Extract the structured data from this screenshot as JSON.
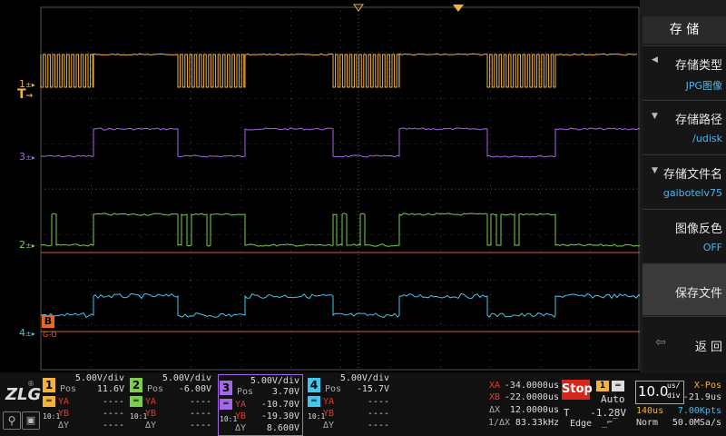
{
  "menu": {
    "title": "存 储",
    "items": [
      {
        "label": "存储类型",
        "value": "JPG图像"
      },
      {
        "label": "存储路径",
        "value": "/udisk"
      },
      {
        "label": "存储文件名",
        "value": "gaibotelv75"
      },
      {
        "label": "图像反色",
        "value": "OFF"
      },
      {
        "label": "保存文件"
      },
      {
        "label": "返 回"
      }
    ]
  },
  "markers": {
    "ch1": "1",
    "ch2": "2",
    "ch3": "3",
    "ch4": "4",
    "math_b": "B",
    "math_b_sub": "G-O",
    "trig": "T"
  },
  "channels": [
    {
      "num": "1",
      "color": "#f2b33d",
      "scale": "5.00V/div",
      "pos_label": "Pos",
      "pos": "11.6V",
      "ya_label": "YA",
      "ya": "----",
      "yb_label": "YB",
      "yb": "----",
      "dy_label": "ΔY",
      "dy": "----",
      "probe": "10:1"
    },
    {
      "num": "2",
      "color": "#7ccd4e",
      "scale": "5.00V/div",
      "pos_label": "Pos",
      "pos": "-6.00V",
      "ya_label": "YA",
      "ya": "----",
      "yb_label": "YB",
      "yb": "----",
      "dy_label": "ΔY",
      "dy": "----",
      "probe": "10:1"
    },
    {
      "num": "3",
      "color": "#a268e8",
      "scale": "5.00V/div",
      "pos_label": "Pos",
      "pos": "3.70V",
      "ya_label": "YA",
      "ya": "-10.70V",
      "yb_label": "YB",
      "yb": "-19.30V",
      "dy_label": "ΔY",
      "dy": "8.600V",
      "probe": "10:1"
    },
    {
      "num": "4",
      "color": "#47c4ea",
      "scale": "5.00V/div",
      "pos_label": "Pos",
      "pos": "-15.7V",
      "ya_label": "YA",
      "ya": "----",
      "yb_label": "YB",
      "yb": "----",
      "dy_label": "ΔY",
      "dy": "----",
      "probe": "10:1"
    }
  ],
  "cursors": {
    "xa_label": "XA",
    "xa": "-34.0000us",
    "xb_label": "XB",
    "xb": "-22.0000us",
    "dx_label": "ΔX",
    "dx": "12.0000us",
    "inv_label": "1/ΔX",
    "inv": "83.33kHz"
  },
  "trigger": {
    "state": "Stop",
    "source": "1",
    "mode": "Auto",
    "t_label": "T",
    "level": "-1.28V",
    "type": "Edge"
  },
  "timebase": {
    "value": "10.0",
    "unit_top": "us/",
    "unit_bottom": "div",
    "xpos_label": "X-Pos",
    "xpos": "-21.9us",
    "mem": "140us",
    "pts": "7.00Kpts",
    "mode": "Norm",
    "rate": "50.0MSa/s"
  },
  "brand": "ZLG"
}
